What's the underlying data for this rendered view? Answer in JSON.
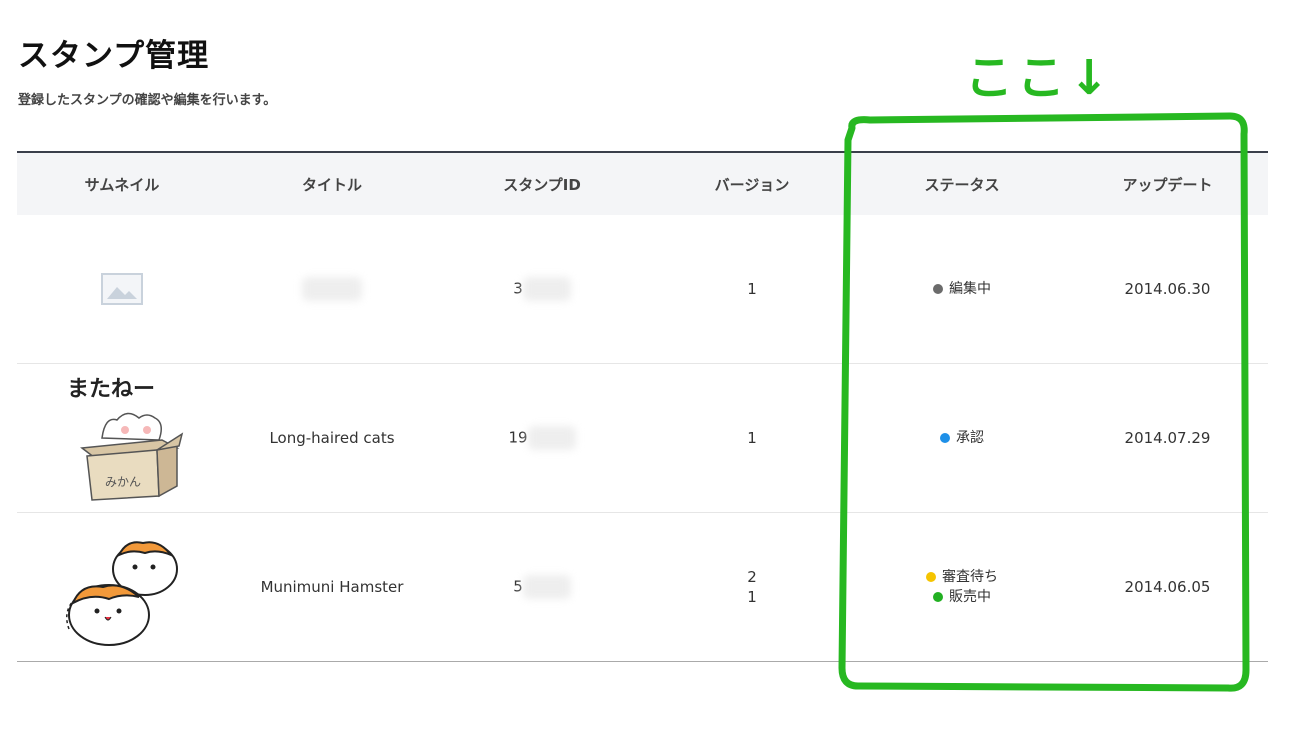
{
  "page": {
    "title": "スタンプ管理",
    "subtitle": "登録したスタンプの確認や編集を行います。"
  },
  "table": {
    "headers": [
      "サムネイル",
      "タイトル",
      "スタンプID",
      "バージョン",
      "ステータス",
      "アップデート"
    ],
    "rows": [
      {
        "thumbnail": "image-placeholder-icon",
        "id_prefix": "3",
        "versions": [
          "1"
        ],
        "statuses": [
          {
            "label": "編集中",
            "color": "#6b6b6b"
          }
        ],
        "updated": "2014.06.30"
      },
      {
        "thumbnail": "cat-in-box-sticker",
        "thumb_text": "またねー",
        "box_text": "みかん",
        "title": "Long-haired cats",
        "id_prefix": "19",
        "versions": [
          "1"
        ],
        "statuses": [
          {
            "label": "承認",
            "color": "#1e90e8"
          }
        ],
        "updated": "2014.07.29"
      },
      {
        "thumbnail": "hamster-sticker",
        "title": "Munimuni Hamster",
        "id_prefix": "5",
        "versions": [
          "2",
          "1"
        ],
        "statuses": [
          {
            "label": "審査待ち",
            "color": "#f5c400"
          },
          {
            "label": "販売中",
            "color": "#22b022"
          }
        ],
        "updated": "2014.06.05"
      }
    ]
  },
  "annotation": {
    "text": "ここ↓",
    "color": "#27b821"
  }
}
